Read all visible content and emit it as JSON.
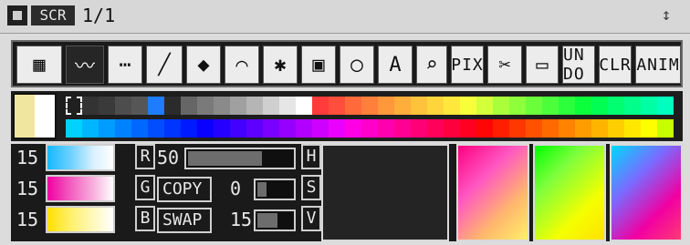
{
  "titlebar": {
    "label": "1/1",
    "chip_text": "SCR",
    "system_icon": "system-box-icon",
    "corner_icon": "resize-icon"
  },
  "toolbar": {
    "tools": [
      {
        "name": "brush-shapes",
        "icon": "brush-shapes-icon"
      },
      {
        "name": "freehand",
        "icon": "freehand-icon",
        "active": true
      },
      {
        "name": "dotted",
        "icon": "dotted-line-icon"
      },
      {
        "name": "line",
        "icon": "line-icon"
      },
      {
        "name": "fill",
        "icon": "fill-icon"
      },
      {
        "name": "curve",
        "icon": "curve-icon"
      },
      {
        "name": "airbrush",
        "icon": "airbrush-icon"
      },
      {
        "name": "rectangle",
        "icon": "rectangle-icon"
      },
      {
        "name": "ellipse",
        "icon": "ellipse-icon"
      },
      {
        "name": "text",
        "icon": "text-icon"
      },
      {
        "name": "magnify",
        "icon": "magnify-icon"
      },
      {
        "name": "pix",
        "label": "PIX"
      },
      {
        "name": "cut",
        "icon": "scissors-icon"
      },
      {
        "name": "erase",
        "icon": "eraser-icon"
      },
      {
        "name": "undo",
        "label": "UN\nDO"
      },
      {
        "name": "clr",
        "label": "CLR"
      },
      {
        "name": "anim",
        "label": "ANIM"
      }
    ]
  },
  "palette": {
    "row1": [
      "#202020",
      "#333333",
      "#3a3a3a",
      "#4d4d4d",
      "#565656",
      "#1e7cff",
      "#2b2b2b",
      "#666666",
      "#7a7a7a",
      "#8a8a8a",
      "#a0a0a0",
      "#b5b5b5",
      "#cfcfcf",
      "#e6e6e6",
      "#ffffff",
      "#ff3b3b",
      "#ff4e3b",
      "#ff6a3b",
      "#ff7f3b",
      "#ff973b",
      "#ffad3b",
      "#ffc23b",
      "#ffd53b",
      "#ffe83b",
      "#f7ff3b",
      "#d4ff3b",
      "#aaff3b",
      "#8dff3b",
      "#6bff3b",
      "#4cff3b",
      "#2cff3b",
      "#0bff3b",
      "#00ff52",
      "#00ff70",
      "#00ff8a",
      "#00ffa5",
      "#00ffbf"
    ],
    "row2": [
      "#00d1ff",
      "#00b6ff",
      "#009cff",
      "#0082ff",
      "#0068ff",
      "#004eff",
      "#0034ff",
      "#001aff",
      "#0a00ff",
      "#2600ff",
      "#4200ff",
      "#5e00ff",
      "#7a00ff",
      "#9600ff",
      "#b200ff",
      "#ce00ff",
      "#ea00ff",
      "#ff00e6",
      "#ff00ca",
      "#ff00ae",
      "#ff0092",
      "#ff0076",
      "#ff005a",
      "#ff003e",
      "#ff0022",
      "#ff0606",
      "#ff1f00",
      "#ff3800",
      "#ff5100",
      "#ff6a00",
      "#ff8300",
      "#ff9c00",
      "#ffb500",
      "#ffce00",
      "#ffe700",
      "#fbff00",
      "#c8ff00"
    ],
    "fg": "#f1e6a0",
    "bg": "#ffffff"
  },
  "panel": {
    "rgb": [
      {
        "value": "15"
      },
      {
        "value": "15"
      },
      {
        "value": "15"
      }
    ],
    "letters_rgb": [
      "R",
      "G",
      "B"
    ],
    "letters_hsv": [
      "H",
      "S",
      "V"
    ],
    "slider_top": {
      "value": "50",
      "fill_pct": 70
    },
    "copy": {
      "label": "COPY",
      "value": "0",
      "fill_pct": 25
    },
    "swap": {
      "label": "SWAP",
      "value": "15",
      "fill_pct": 55
    }
  }
}
